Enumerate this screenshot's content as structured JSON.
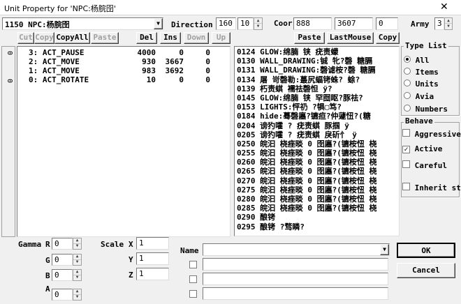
{
  "window": {
    "title": "Unit Property for 'NPC:杨脘囹'",
    "close_glyph": "✕"
  },
  "unit_select": {
    "value": "1150 NPC:杨脘囹"
  },
  "direction": {
    "label": "Direction",
    "value1": "160",
    "value2": "10"
  },
  "coor": {
    "label": "Coor",
    "x": "888",
    "y": "3607",
    "z": "0"
  },
  "army": {
    "label": "Army",
    "value": "3"
  },
  "left_toolbar": {
    "cut": "Cut",
    "copy": "Copy",
    "copy_all": "CopyAll",
    "paste": "Paste",
    "del": "Del",
    "ins": "Ins",
    "down": "Down",
    "up": "Up"
  },
  "right_toolbar": {
    "paste": "Paste",
    "last_mouse": "LastMouse",
    "copy": "Copy"
  },
  "side_labels": [
    "0",
    "0"
  ],
  "actions": [
    {
      "text": "3: ACT_PAUSE",
      "v1": "4000",
      "v2": "0",
      "v3": "0"
    },
    {
      "text": "2: ACT_MOVE",
      "v1": "930",
      "v2": "3667",
      "v3": "0"
    },
    {
      "text": "1: ACT_MOVE",
      "v1": "983",
      "v2": "3692",
      "v3": "0"
    },
    {
      "text": "0: ACT_ROTATE",
      "v1": "10",
      "v2": "0",
      "v3": "0"
    }
  ],
  "script_lines": [
    "0124 GLOW:绵腩 铗 疣责蠓",
    "0130 WALL_DRAWING:铖 牝?磬 糖膈",
    "0131 WALL_DRAWING:磬谑桉?磬 糖膈",
    "0134 屠 岢磬勒:蕞尻蝠铐蛛? 蜍?",
    "0139 朽责蜞 襦祛磬怛 ÿ?",
    "0145 GLOW:绵腩 铗 罕囫眍?豚祛?",
    "0153 LIGHTS:怦礽  ?犋▢笃?",
    "0184 hide:蓦磬廛?镳疸?仲蘧忸?(糖",
    "0204 谤犳嚯  ? 疣责蜞 豚掴  ÿ",
    "0205 谤犳嚯  ? 疣责蜞 戾斫忄 ÿ",
    "0250 皖汩 桡痤晱 0 囹廛?(镳桉忸 桡",
    "0255 皖汩 桡痤晱 0 囹廛?(镳桉忸 桡",
    "0260 皖汩 桡痤晱 0 囹廛?(镳桉忸 桡",
    "0265 皖汩 桡痤晱 0 囹廛?(镳桉忸 桡",
    "0270 皖汩 桡痤晱 0 囹廛?(镳桉忸 桡",
    "0275 皖汩 桡痤晱 0 囹廛?(镳桉忸 桡",
    "0280 皖汩 桡痤晱 0 囹廛?(镳桉忸 桡",
    "0285 皖汩 桡痤晱 0 囹廛?(镳桉忸 桡",
    "0290 酿铐",
    "0295 酿铐  ?骛瞵?"
  ],
  "type_list": {
    "title": "Type List",
    "options": [
      "All",
      "Items",
      "Units",
      "Avia",
      "Numbers"
    ],
    "selected": 0
  },
  "behave": {
    "title": "Behave",
    "aggressive": "Aggressive",
    "active": "Active",
    "careful": "Careful",
    "inherit": "Inherit st"
  },
  "gamma": {
    "label": "Gamma",
    "r_label": "R",
    "g_label": "G",
    "b_label": "B",
    "a_label": "A",
    "r": "0",
    "g": "0",
    "b": "0",
    "a": "0"
  },
  "scale": {
    "label": "Scale",
    "x_label": "X",
    "y_label": "Y",
    "z_label": "Z",
    "x": "1",
    "y": "1",
    "z": "1"
  },
  "name": {
    "label": "Name",
    "value": ""
  },
  "buttons": {
    "ok": "OK",
    "cancel": "Cancel"
  }
}
